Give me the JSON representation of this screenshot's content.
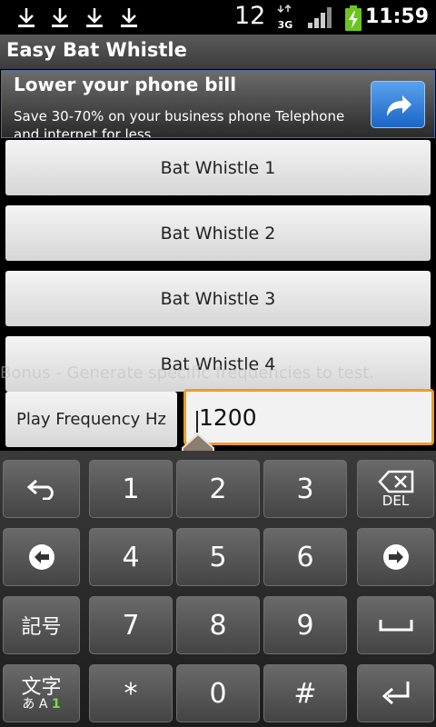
{
  "status": {
    "notification_count": "12",
    "time": "11:59"
  },
  "app": {
    "title": "Easy Bat Whistle"
  },
  "ad": {
    "title": "Lower your phone bill",
    "text": "Save 30-70% on your business phone Telephone and internet for less"
  },
  "buttons": [
    "Bat Whistle 1",
    "Bat Whistle 2",
    "Bat Whistle 3",
    "Bat Whistle 4"
  ],
  "bonus_text": "Bonus - Generate specific frequencies to test.",
  "play_button": "Play Frequency Hz",
  "frequency_value": "1200",
  "keyboard": {
    "digits": [
      "1",
      "2",
      "3",
      "4",
      "5",
      "6",
      "7",
      "8",
      "9",
      "*",
      "0",
      "#"
    ],
    "symbols_label": "記号",
    "mode_label": "文字",
    "mode_sub_prefix": "あ A ",
    "mode_sub_num": "1",
    "del_label": "DEL"
  },
  "colors": {
    "input_border": "#f09a20",
    "ad_button": "#2a78d8",
    "battery": "#6cc421"
  }
}
